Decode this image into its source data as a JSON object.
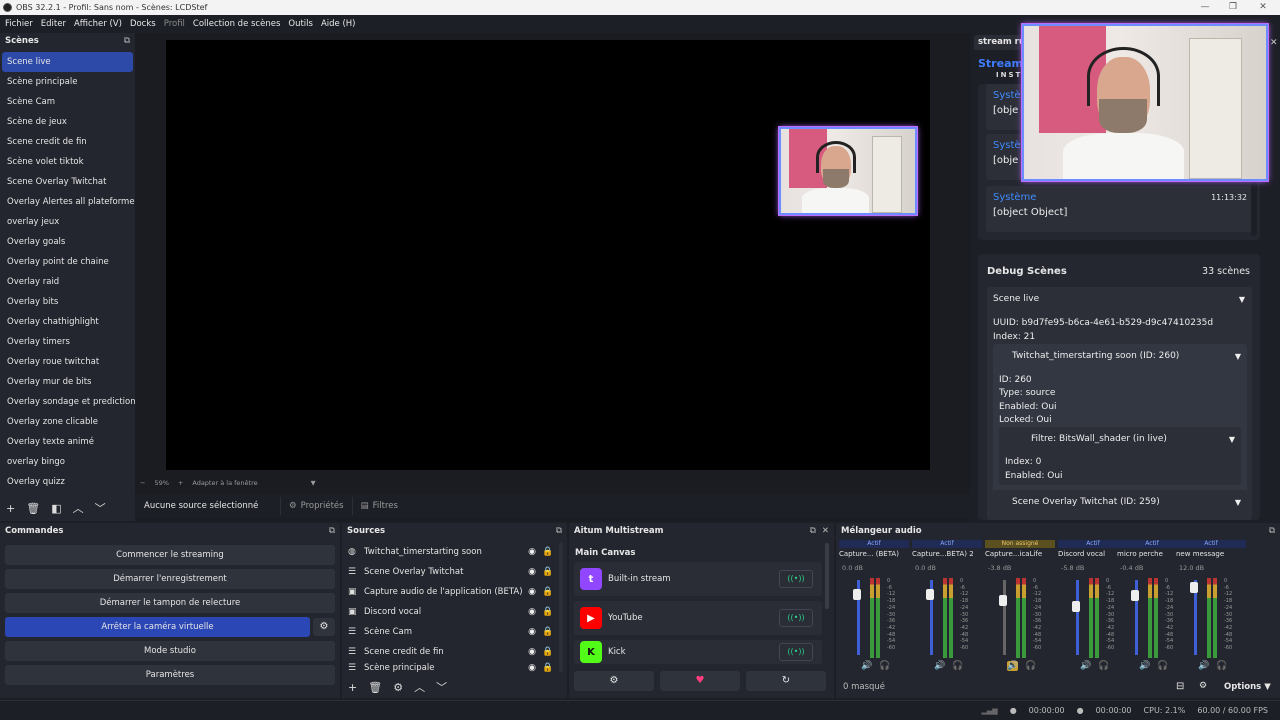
{
  "titlebar": {
    "title": "OBS 32.2.1 - Profil: Sans nom - Scènes: LCDStef"
  },
  "menu": [
    "Fichier",
    "Editer",
    "Afficher (V)",
    "Docks",
    "Profil",
    "Collection de scènes",
    "Outils",
    "Aide (H)"
  ],
  "scenes": {
    "title": "Scènes",
    "items": [
      "Scene live",
      "Scène principale",
      "Scène Cam",
      "Scène de jeux",
      "Scene credit de fin",
      "Scène volet tiktok",
      "Scene Overlay Twitchat",
      "Overlay Alertes all plateforme",
      "overlay jeux",
      "Overlay goals",
      "Overlay point de chaine",
      "Overlay raid",
      "Overlay bits",
      "Overlay chathighlight",
      "Overlay timers",
      "Overlay roue twitchat",
      "Overlay mur de bits",
      "Overlay sondage et prediction",
      "Overlay zone clicable",
      "Overlay texte animé",
      "overlay bingo",
      "Overlay quizz"
    ]
  },
  "preview": {
    "zoom": "59%",
    "fit": "Adapter à la fenêtre",
    "no_source": "Aucune source sélectionné",
    "properties": "Propriétés",
    "filters": "Filtres"
  },
  "right": {
    "tab": "stream ru",
    "brand": "Stream",
    "brand_sub": "INST",
    "logs": [
      {
        "title": "Systè",
        "msg": "[obje",
        "time": ""
      },
      {
        "title": "Systè",
        "msg": "[obje",
        "time": ""
      },
      {
        "title": "Système",
        "msg": "[object Object]",
        "time": "11:13:32"
      }
    ],
    "first_log_msg": "[object Object]"
  },
  "debug": {
    "title": "Debug Scènes",
    "count": "33 scènes",
    "scene": "Scene live",
    "uuid": "UUID: b9d7fe95-b6ca-4e61-b529-d9c47410235d",
    "index": "Index: 21",
    "source": "Twitchat_timerstarting soon (ID: 260)",
    "src_id": "ID: 260",
    "src_type": "Type: source",
    "src_enabled": "Enabled: Oui",
    "src_locked": "Locked: Oui",
    "filter": "Filtre: BitsWall_shader (in live)",
    "f_index": "Index: 0",
    "f_enabled": "Enabled: Oui",
    "next": "Scene Overlay Twitchat (ID: 259)"
  },
  "commands": {
    "title": "Commandes",
    "buttons": [
      "Commencer le streaming",
      "Démarrer l'enregistrement",
      "Démarrer le tampon de relecture",
      "Arrêter la caméra virtuelle",
      "Mode studio",
      "Paramètres"
    ]
  },
  "sources": {
    "title": "Sources",
    "items": [
      "Twitchat_timerstarting soon",
      "Scene Overlay Twitchat",
      "Capture audio de l'application (BÊTA)",
      "Discord vocal",
      "Scène Cam",
      "Scene credit de fin",
      "Scène principale"
    ]
  },
  "aitum": {
    "title": "Aitum Multistream",
    "canvas": "Main Canvas",
    "platforms": [
      {
        "name": "Built-in stream",
        "color": "#9146ff"
      },
      {
        "name": "YouTube",
        "color": "#ff0000"
      },
      {
        "name": "Kick",
        "color": "#53fc18"
      }
    ]
  },
  "mixer": {
    "title": "Mélangeur audio",
    "channels": [
      {
        "status": "Actif",
        "name": "Capture... (BÊTA)",
        "db": "0.0 dB",
        "level": 0.15
      },
      {
        "status": "Actif",
        "name": "Capture...BÊTA) 2",
        "db": "0.0 dB",
        "level": 0.15
      },
      {
        "status": "Non assigné",
        "name": "Capture...icaLife",
        "db": "-3.8 dB",
        "level": 0.22
      },
      {
        "status": "Actif",
        "name": "Discord vocal",
        "db": "-5.8 dB",
        "level": 0.3
      },
      {
        "status": "Actif",
        "name": "micro perche",
        "db": "-0.4 dB",
        "level": 0.16
      },
      {
        "status": "Actif",
        "name": "new message",
        "db": "12.0 dB",
        "level": 0.05
      }
    ],
    "scale": [
      "0",
      "-6",
      "-12",
      "-18",
      "-24",
      "-30",
      "-36",
      "-42",
      "-48",
      "-54",
      "-60"
    ],
    "masked": "0 masqué",
    "options": "Options"
  },
  "status": {
    "rec1": "00:00:00",
    "rec2": "00:00:00",
    "cpu": "CPU: 2.1%",
    "fps": "60.00 / 60.00 FPS"
  }
}
